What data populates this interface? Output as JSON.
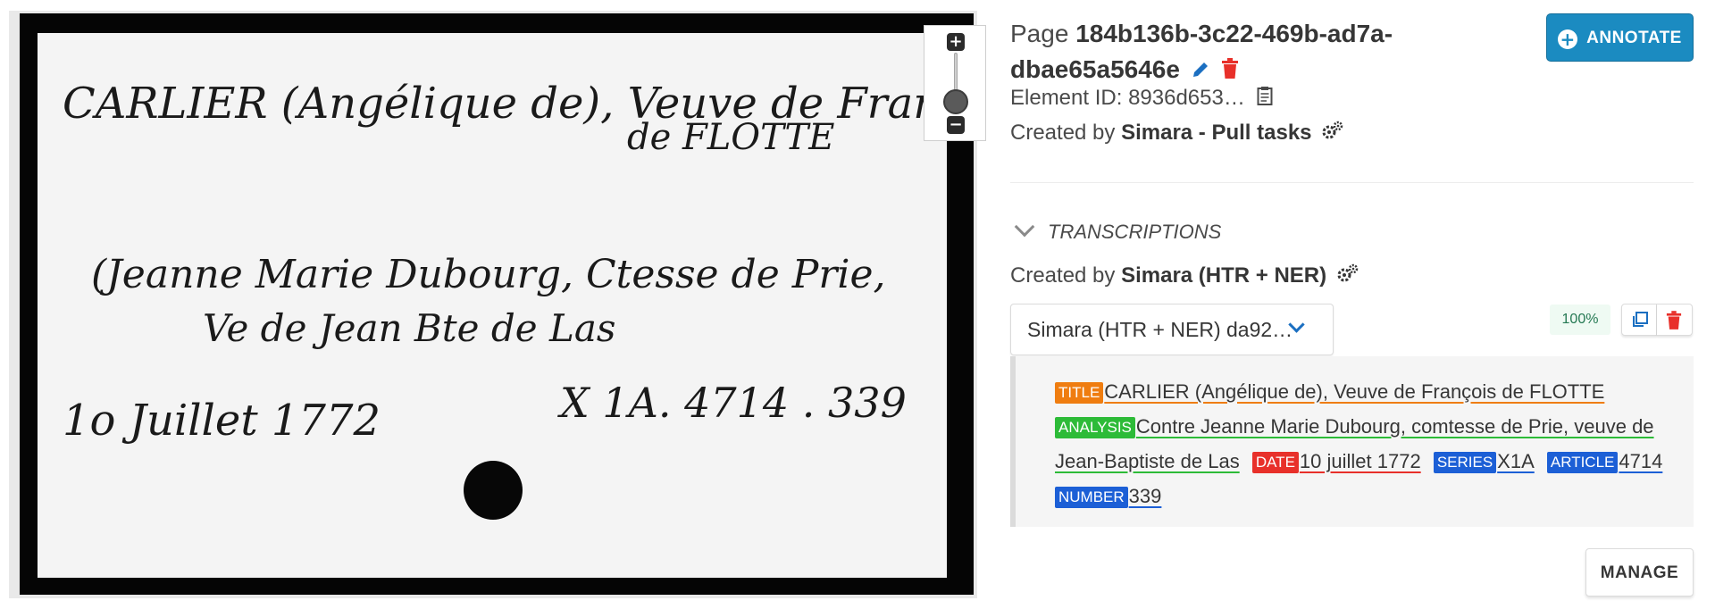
{
  "image_viewer": {
    "card_text": {
      "line1": "CARLIER (Angélique de), Veuve de François",
      "line2": "de FLOTTE",
      "line3": "(Jeanne Marie Dubourg, Ctesse de Prie,",
      "line4": "Ve de Jean Bte de Las",
      "line5": "1o Juillet 1772",
      "line6": "X 1A. 4714 . 339"
    },
    "zoom": {
      "in_symbol": "+",
      "out_symbol": "−",
      "level": 0.0
    }
  },
  "header": {
    "page_label": "Page",
    "page_id": "184b136b-3c22-469b-ad7a-dbae65a5646e",
    "element_id_label": "Element ID:",
    "element_id_value": "8936d653…",
    "created_by_label": "Created by",
    "created_by_value": "Simara - Pull tasks",
    "annotate_label": "ANNOTATE"
  },
  "transcriptions": {
    "section_label": "TRANSCRIPTIONS",
    "created_by_label": "Created by",
    "created_by_value": "Simara (HTR + NER)",
    "selected_version": "Simara (HTR + NER) da92…",
    "confidence": "100%",
    "manage_label": "MANAGE",
    "entities": [
      {
        "type": "TITLE",
        "text": "CARLIER (Angélique de), Veuve de François de FLOTTE",
        "color": "#ef7d10"
      },
      {
        "type": "ANALYSIS",
        "text": "Contre Jeanne Marie Dubourg, comtesse de Prie, veuve de Jean-Baptiste de Las",
        "color": "#2dbb38"
      },
      {
        "type": "DATE",
        "text": "10 juillet 1772",
        "color": "#e8302a"
      },
      {
        "type": "SERIES",
        "text": "X1A",
        "color": "#1c5fd6"
      },
      {
        "type": "ARTICLE",
        "text": "4714",
        "color": "#1c5fd6"
      },
      {
        "type": "NUMBER",
        "text": "339",
        "color": "#1c5fd6"
      }
    ]
  },
  "colors": {
    "primary": "#1b8bc1",
    "delete": "#e8302a",
    "confidence_text": "#257953"
  }
}
